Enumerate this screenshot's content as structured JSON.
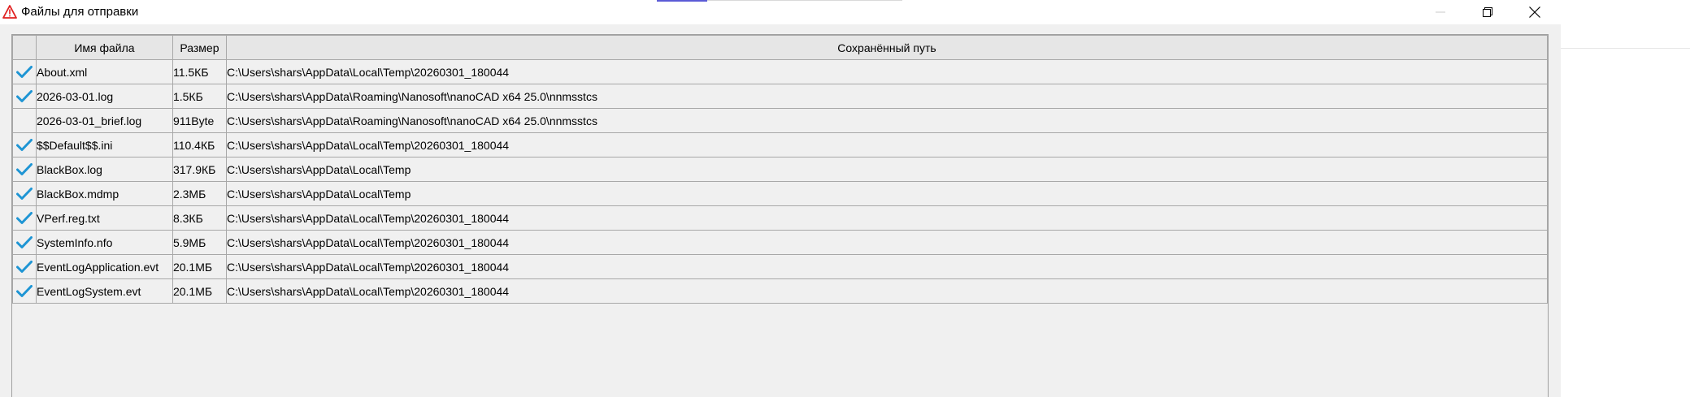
{
  "window": {
    "title": "Файлы для отправки"
  },
  "titlebar_buttons": {
    "minimize_icon": "minimize-icon",
    "maximize_icon": "restore-icon",
    "close_icon": "close-icon"
  },
  "colors": {
    "check": "#1e95d4",
    "app_icon": "#e02020"
  },
  "grid": {
    "columns": [
      "",
      "Имя файла",
      "Размер",
      "Сохранённый путь"
    ],
    "rows": [
      {
        "checked": true,
        "name": "About.xml",
        "size": "11.5КБ",
        "path": "C:\\Users\\shars\\AppData\\Local\\Temp\\20260301_180044"
      },
      {
        "checked": true,
        "name": "2026-03-01.log",
        "size": "1.5КБ",
        "path": "C:\\Users\\shars\\AppData\\Roaming\\Nanosoft\\nanoCAD x64 25.0\\nnmsstcs"
      },
      {
        "checked": false,
        "name": "2026-03-01_brief.log",
        "size": "911Byte",
        "path": "C:\\Users\\shars\\AppData\\Roaming\\Nanosoft\\nanoCAD x64 25.0\\nnmsstcs"
      },
      {
        "checked": true,
        "name": "$$Default$$.ini",
        "size": "110.4КБ",
        "path": "C:\\Users\\shars\\AppData\\Local\\Temp\\20260301_180044"
      },
      {
        "checked": true,
        "name": "BlackBox.log",
        "size": "317.9КБ",
        "path": "C:\\Users\\shars\\AppData\\Local\\Temp"
      },
      {
        "checked": true,
        "name": "BlackBox.mdmp",
        "size": "2.3МБ",
        "path": "C:\\Users\\shars\\AppData\\Local\\Temp"
      },
      {
        "checked": true,
        "name": "VPerf.reg.txt",
        "size": "8.3КБ",
        "path": "C:\\Users\\shars\\AppData\\Local\\Temp\\20260301_180044"
      },
      {
        "checked": true,
        "name": "SystemInfo.nfo",
        "size": "5.9МБ",
        "path": "C:\\Users\\shars\\AppData\\Local\\Temp\\20260301_180044"
      },
      {
        "checked": true,
        "name": "EventLogApplication.evt",
        "size": "20.1МБ",
        "path": "C:\\Users\\shars\\AppData\\Local\\Temp\\20260301_180044"
      },
      {
        "checked": true,
        "name": "EventLogSystem.evt",
        "size": "20.1МБ",
        "path": "C:\\Users\\shars\\AppData\\Local\\Temp\\20260301_180044"
      }
    ]
  }
}
